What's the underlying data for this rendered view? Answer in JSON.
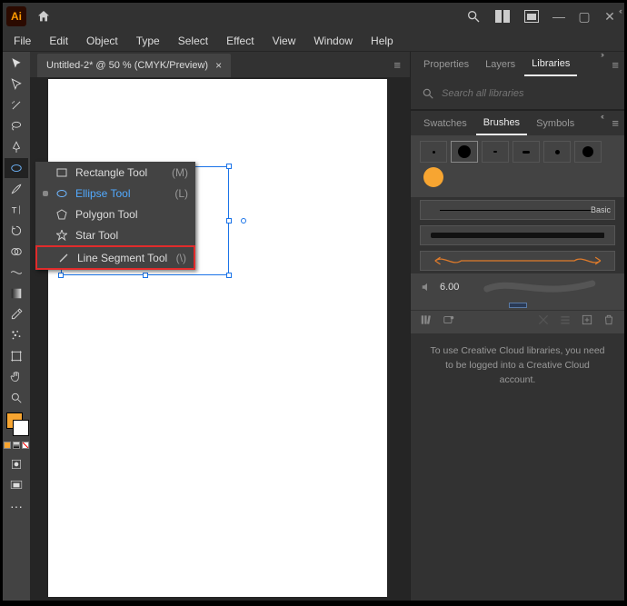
{
  "menubar": [
    "File",
    "Edit",
    "Object",
    "Type",
    "Select",
    "Effect",
    "View",
    "Window",
    "Help"
  ],
  "doc_tab": {
    "label": "Untitled-2* @ 50 % (CMYK/Preview)"
  },
  "flyout": [
    {
      "name": "Rectangle Tool",
      "shortcut": "(M)",
      "active": false,
      "hl": false,
      "icon": "rect"
    },
    {
      "name": "Ellipse Tool",
      "shortcut": "(L)",
      "active": true,
      "hl": false,
      "icon": "ellipse"
    },
    {
      "name": "Polygon Tool",
      "shortcut": "",
      "active": false,
      "hl": false,
      "icon": "poly"
    },
    {
      "name": "Star Tool",
      "shortcut": "",
      "active": false,
      "hl": false,
      "icon": "star"
    },
    {
      "name": "Line Segment Tool",
      "shortcut": "(\\)",
      "active": false,
      "hl": true,
      "icon": "line"
    }
  ],
  "panels": {
    "top_tabs": [
      "Properties",
      "Layers",
      "Libraries"
    ],
    "top_active": 2,
    "search_placeholder": "Search all libraries",
    "brush_tabs": [
      "Swatches",
      "Brushes",
      "Symbols"
    ],
    "brush_active": 1,
    "basic_label": "Basic",
    "volume_value": "6.00",
    "cc_message": "To use Creative Cloud libraries, you need to be logged into a Creative Cloud account."
  }
}
